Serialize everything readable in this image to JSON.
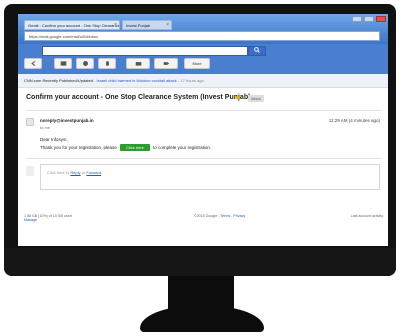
{
  "browser": {
    "tab_primary": "Gmail - Confirm your account - One Stop Clearance",
    "tab_secondary": "Invest Punjab",
    "address": "https://mail.google.com/mail/u/0/#inbox"
  },
  "toolbar": {
    "back_icon": "back-arrow-icon",
    "archive_icon": "archive-icon",
    "spam_icon": "report-spam-icon",
    "delete_icon": "trash-icon",
    "folder_icon": "folder-icon",
    "labels_icon": "tag-icon",
    "more_label": "More"
  },
  "notice": {
    "source": "CNN.com Recently Published/Updated",
    "headline": "Israeli child harmed in Molotov cocktail attack",
    "age": "17 hours ago"
  },
  "email": {
    "subject": "Confirm your account - One Stop Clearance System (Invest Punjab)",
    "label": "Inbox",
    "sender": "noreply@investpunjab.in",
    "to": "to me",
    "timestamp": "11:29 AM (4 minutes ago)",
    "greeting": "Dear Infosys!,",
    "body_before": "Thank you for your registration, please",
    "cta_label": "Click here",
    "body_after": "to complete your registration."
  },
  "reply": {
    "prefix": "Click here to",
    "reply_link": "Reply",
    "or": "or",
    "forward_link": "Forward"
  },
  "footer": {
    "storage": "1.58 GB (10%) of 15 GB used",
    "manage": "Manage",
    "terms_prefix": "©2015 Google -",
    "terms": "Terms",
    "privacy": "Privacy",
    "activity": "Last account activity:"
  },
  "colors": {
    "gmail_blue": "#4a7fd0",
    "cta_green": "#2e9b2e",
    "star": "#e5b800"
  }
}
